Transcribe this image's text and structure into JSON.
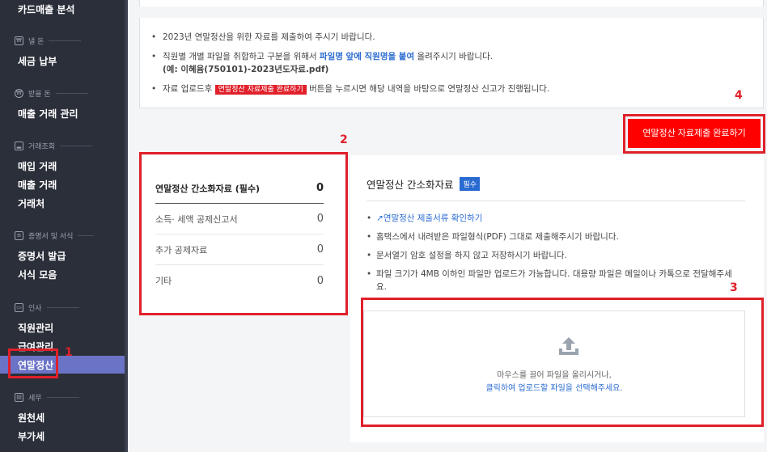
{
  "sidebar": {
    "items": {
      "card_sales": "카드매출 분석",
      "tax_payment": "세금 납부",
      "sales_transaction": "매출 거래 관리",
      "purchase": "매입 거래",
      "sales": "매출 거래",
      "vendors": "거래처",
      "certificate": "증명서 발급",
      "forms": "서식 모음",
      "employees": "직원관리",
      "payroll": "급여관리",
      "year_end": "연말정산",
      "withholding": "원천세",
      "vat": "부가세"
    },
    "sections": {
      "pay_money": "낼 돈",
      "receive_money": "받을 돈",
      "transactions": "거래조회",
      "docs": "증명서 및 서식",
      "hr": "인사",
      "tax": "세무"
    },
    "active_color": "#6b73c6"
  },
  "notice": {
    "line1": "2023년 연말정산을 위한 자료를 제출하여 주시기 바랍니다.",
    "line2_pre": "직원별 개별 파일을 취합하고 구분을 위해서 ",
    "line2_bold": "파일명 앞에 직원명을 붙여",
    "line2_post": " 올려주시기 바랍니다.",
    "line2_example": "(예: 이혜윰(750101)-2023년도자료.pdf)",
    "line3_pre": "자료 업로드후 ",
    "line3_badge": "연말정산 자료제출 완료하기",
    "line3_post": " 버튼을 누르시면 해당 내역을 바탕으로 연말정산 신고가 진행됩니다."
  },
  "submit_button": "연말정산 자료제출 완료하기",
  "categories": [
    {
      "label": "연말정산 간소화자료 (필수)",
      "count": "0"
    },
    {
      "label": "소득· 세액 공제신고서",
      "count": "0"
    },
    {
      "label": "추가 공제자료",
      "count": "0"
    },
    {
      "label": "기타",
      "count": "0"
    }
  ],
  "detail": {
    "title": "연말정산 간소화자료",
    "badge": "필수",
    "link": "연말정산 제출서류 확인하기",
    "bullet2": "홈택스에서 내려받은 파일형식(PDF) 그대로 제출해주시기 바랍니다.",
    "bullet3": "문서열기 암호 설정을 하지 않고 저장하시기 바랍니다.",
    "bullet4": "파일 크기가 4MB 이하인 파일만 업로드가 가능합니다. 대용량 파일은 메일이나 카톡으로 전달해주세요.",
    "dropzone_line1": "마우스를 끌어 파일을 올리시거나,",
    "dropzone_line2": "클릭하여 업로드할 파일을 선택해주세요."
  },
  "annotations": [
    "1",
    "2",
    "3",
    "4"
  ],
  "colors": {
    "red": "#e0202a",
    "blue": "#2a6bd1",
    "sidebar": "#2b2f3a",
    "button": "#ff0000"
  }
}
